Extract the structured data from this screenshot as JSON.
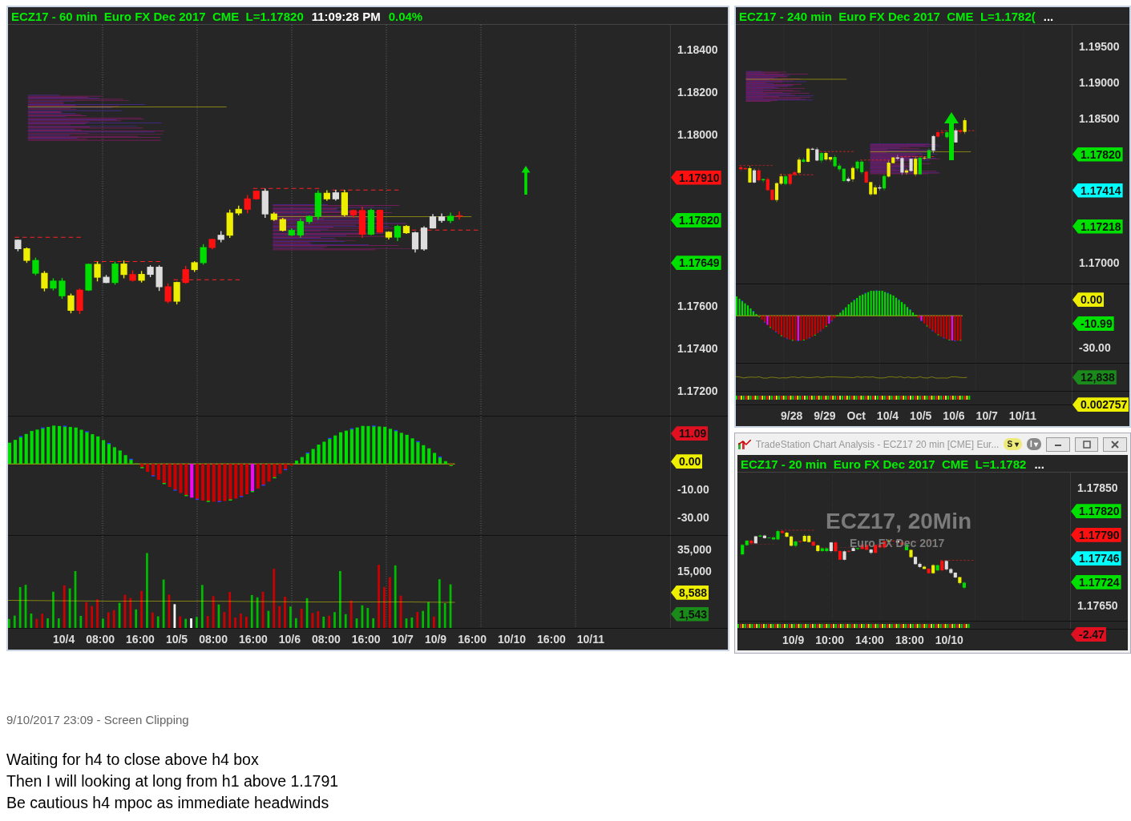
{
  "charts": [
    {
      "header": [
        {
          "text": "ECZ17 - 60 min  Euro FX Dec 2017  CME  L=1.17820",
          "kind": "title"
        },
        {
          "text": "11:09:28 PM",
          "kind": "clock"
        },
        {
          "text": "0.04%",
          "kind": "title"
        }
      ],
      "panes": [
        {
          "kind": "price",
          "axis": [
            {
              "kind": "label",
              "text": "1.18400"
            },
            {
              "kind": "label",
              "text": "1.18200"
            },
            {
              "kind": "label",
              "text": "1.18000"
            },
            {
              "kind": "tag",
              "text": "1.17910",
              "color": "#ff1010"
            },
            {
              "kind": "tag",
              "text": "1.17820",
              "color": "#00e000"
            },
            {
              "kind": "tag",
              "text": "1.17649",
              "color": "#00e000"
            },
            {
              "kind": "label",
              "text": "1.17600"
            },
            {
              "kind": "label",
              "text": "1.17400"
            },
            {
              "kind": "label",
              "text": "1.17200"
            }
          ]
        },
        {
          "kind": "oscillator",
          "axis": [
            {
              "kind": "tag",
              "text": "11.09",
              "color": "#e01020"
            },
            {
              "kind": "tag",
              "text": "0.00",
              "color": "#eeee00"
            },
            {
              "kind": "label",
              "text": "-10.00"
            },
            {
              "kind": "label",
              "text": "-30.00"
            }
          ]
        },
        {
          "kind": "volume",
          "axis": [
            {
              "kind": "label",
              "text": "35,000"
            },
            {
              "kind": "label",
              "text": "15,000"
            },
            {
              "kind": "tag",
              "text": "8,588",
              "color": "#eeee00"
            },
            {
              "kind": "tag",
              "text": "1,543",
              "color": "#1a8a1a"
            }
          ]
        }
      ],
      "time_axis": [
        "10/4",
        "08:00",
        "16:00",
        "10/5",
        "08:00",
        "16:00",
        "10/6",
        "08:00",
        "16:00",
        "10/7",
        "10/9",
        "16:00",
        "10/10",
        "16:00",
        "10/11"
      ]
    },
    {
      "header": [
        {
          "text": "ECZ17 - 240 min  Euro FX Dec 2017  CME  L=1.1782(",
          "kind": "title"
        },
        {
          "text": "...",
          "kind": "clock"
        }
      ],
      "panes": [
        {
          "kind": "price",
          "axis": [
            {
              "kind": "label",
              "text": "1.19500"
            },
            {
              "kind": "label",
              "text": "1.19000"
            },
            {
              "kind": "label",
              "text": "1.18500"
            },
            {
              "kind": "tag",
              "text": "1.17820",
              "color": "#00e000"
            },
            {
              "kind": "tag",
              "text": "1.17414",
              "color": "#00ffff"
            },
            {
              "kind": "tag",
              "text": "1.17218",
              "color": "#00e000"
            },
            {
              "kind": "label",
              "text": "1.17000"
            }
          ]
        },
        {
          "kind": "oscillator",
          "axis": [
            {
              "kind": "tag",
              "text": "0.00",
              "color": "#eeee00"
            },
            {
              "kind": "tag",
              "text": "-10.99",
              "color": "#00e000"
            },
            {
              "kind": "label",
              "text": "-30.00"
            }
          ]
        },
        {
          "kind": "line",
          "axis": [
            {
              "kind": "tag",
              "text": "12,838",
              "color": "#1a8a1a"
            }
          ]
        },
        {
          "kind": "strip",
          "axis": [
            {
              "kind": "tag",
              "text": "0.002757",
              "color": "#eeee00"
            }
          ]
        }
      ],
      "time_axis": [
        "9/28",
        "9/29",
        "Oct",
        "10/4",
        "10/5",
        "10/6",
        "10/7",
        "10/11"
      ]
    }
  ],
  "window": {
    "title": "TradeStation Chart Analysis - ECZ17 20 min [CME] Eur...",
    "buttons": [
      "S ▾",
      "I ▾"
    ],
    "chart": {
      "header": [
        {
          "text": "ECZ17 - 20 min  Euro FX Dec 2017  CME  L=1.1782",
          "kind": "title"
        },
        {
          "text": "...",
          "kind": "clock"
        }
      ],
      "watermark": [
        "ECZ17, 20Min",
        "Euro FX Dec 2017"
      ],
      "panes": [
        {
          "kind": "price",
          "axis": [
            {
              "kind": "label",
              "text": "1.17850"
            },
            {
              "kind": "tag",
              "text": "1.17820",
              "color": "#00e000"
            },
            {
              "kind": "tag",
              "text": "1.17790",
              "color": "#ff1010"
            },
            {
              "kind": "tag",
              "text": "1.17746",
              "color": "#00ffff"
            },
            {
              "kind": "tag",
              "text": "1.17724",
              "color": "#00e000"
            },
            {
              "kind": "label",
              "text": "1.17650"
            }
          ]
        },
        {
          "kind": "strip",
          "axis": [
            {
              "kind": "tag",
              "text": "-2.47",
              "color": "#e01020"
            }
          ]
        }
      ],
      "time_axis": [
        "10/9",
        "10:00",
        "14:00",
        "18:00",
        "10/10"
      ]
    }
  },
  "note": {
    "timestamp": "9/10/2017 23:09 - Screen Clipping",
    "lines": [
      "Waiting for h4 to close above h4 box",
      "Then I will looking at long from h1 above 1.1791",
      "Be cautious h4 mpoc as immediate headwinds"
    ]
  }
}
